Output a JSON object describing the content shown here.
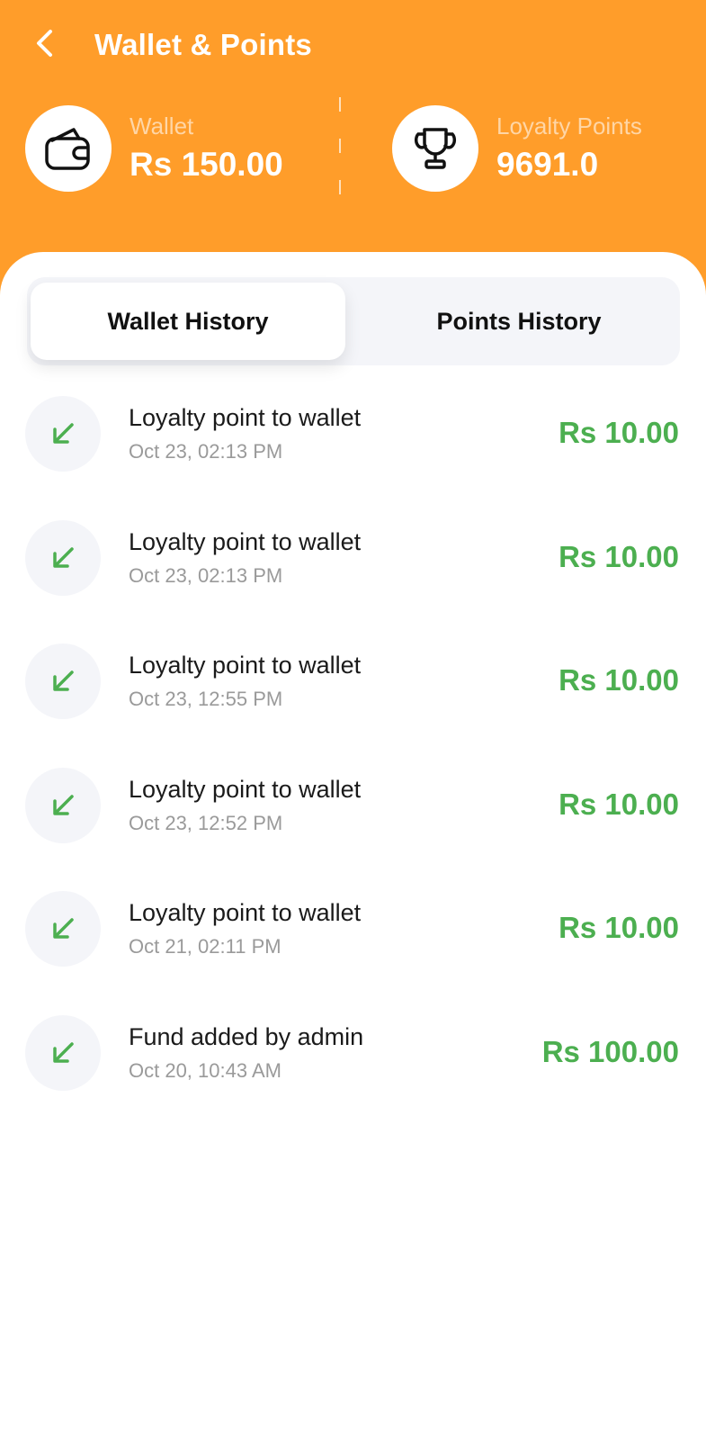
{
  "header": {
    "title": "Wallet & Points",
    "back_icon": "chevron-left-icon"
  },
  "summary": {
    "wallet": {
      "icon": "wallet-icon",
      "label": "Wallet",
      "value": "Rs 150.00"
    },
    "points": {
      "icon": "trophy-icon",
      "label": "Loyalty Points",
      "value": "9691.0"
    }
  },
  "tabs": [
    {
      "label": "Wallet History",
      "active": true
    },
    {
      "label": "Points History",
      "active": false
    }
  ],
  "transactions": [
    {
      "icon": "arrow-down-left-icon",
      "title": "Loyalty point to wallet",
      "date": "Oct 23, 02:13 PM",
      "amount": "Rs 10.00"
    },
    {
      "icon": "arrow-down-left-icon",
      "title": "Loyalty point to wallet",
      "date": "Oct 23, 02:13 PM",
      "amount": "Rs 10.00"
    },
    {
      "icon": "arrow-down-left-icon",
      "title": "Loyalty point to wallet",
      "date": "Oct 23, 12:55 PM",
      "amount": "Rs 10.00"
    },
    {
      "icon": "arrow-down-left-icon",
      "title": "Loyalty point to wallet",
      "date": "Oct 23, 12:52 PM",
      "amount": "Rs 10.00"
    },
    {
      "icon": "arrow-down-left-icon",
      "title": "Loyalty point to wallet",
      "date": "Oct 21, 02:11 PM",
      "amount": "Rs 10.00"
    },
    {
      "icon": "arrow-down-left-icon",
      "title": "Fund added by admin",
      "date": "Oct 20, 10:43 AM",
      "amount": "Rs 100.00"
    }
  ],
  "colors": {
    "accent": "#FF9D2A",
    "credit": "#4CAF50",
    "muted": "#9A9A9A"
  }
}
